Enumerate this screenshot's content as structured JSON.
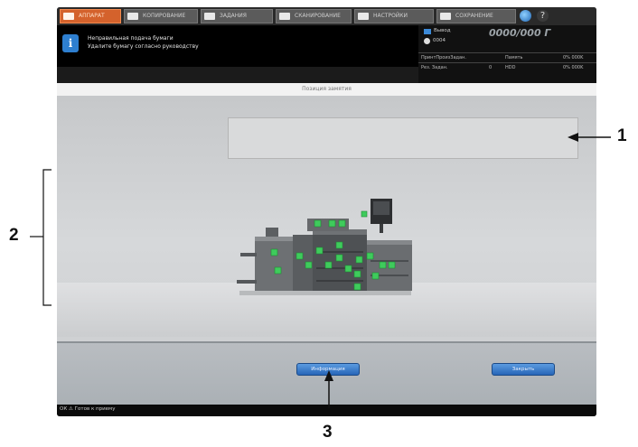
{
  "tabs": [
    {
      "label": "АППАРАТ",
      "active": true
    },
    {
      "label": "КОПИРОВАНИЕ",
      "active": false
    },
    {
      "label": "ЗАДАНИЯ",
      "active": false
    },
    {
      "label": "СКАНИРОВАНИЕ",
      "active": false
    },
    {
      "label": "НАСТРОЙКИ",
      "active": false
    },
    {
      "label": "СОХРАНЕНИЕ",
      "active": false
    }
  ],
  "header": {
    "message_line1": "Неправильная подача бумаги",
    "message_line2": "Удалите бумагу согласно руководству"
  },
  "status_panel": {
    "output_label": "Вывод",
    "counter": "0000/000 Г",
    "sub_count": "0004",
    "rows": [
      [
        "ПринтПроизЗадан.",
        "Память",
        "0% 000K"
      ],
      [
        "Рез. Задан.",
        "0",
        "HDD",
        "0% 000K"
      ]
    ]
  },
  "title": "Позиция замятия",
  "buttons": {
    "info": "Информация",
    "close": "Закрыть"
  },
  "statusbar": {
    "text": "ОК  ⚠ Готов к приему"
  },
  "callouts": [
    "1",
    "2",
    "3"
  ],
  "colors": {
    "active_tab": "#d4622c",
    "button": "#2766b8",
    "jam_indicator": "#3fcb5c"
  }
}
